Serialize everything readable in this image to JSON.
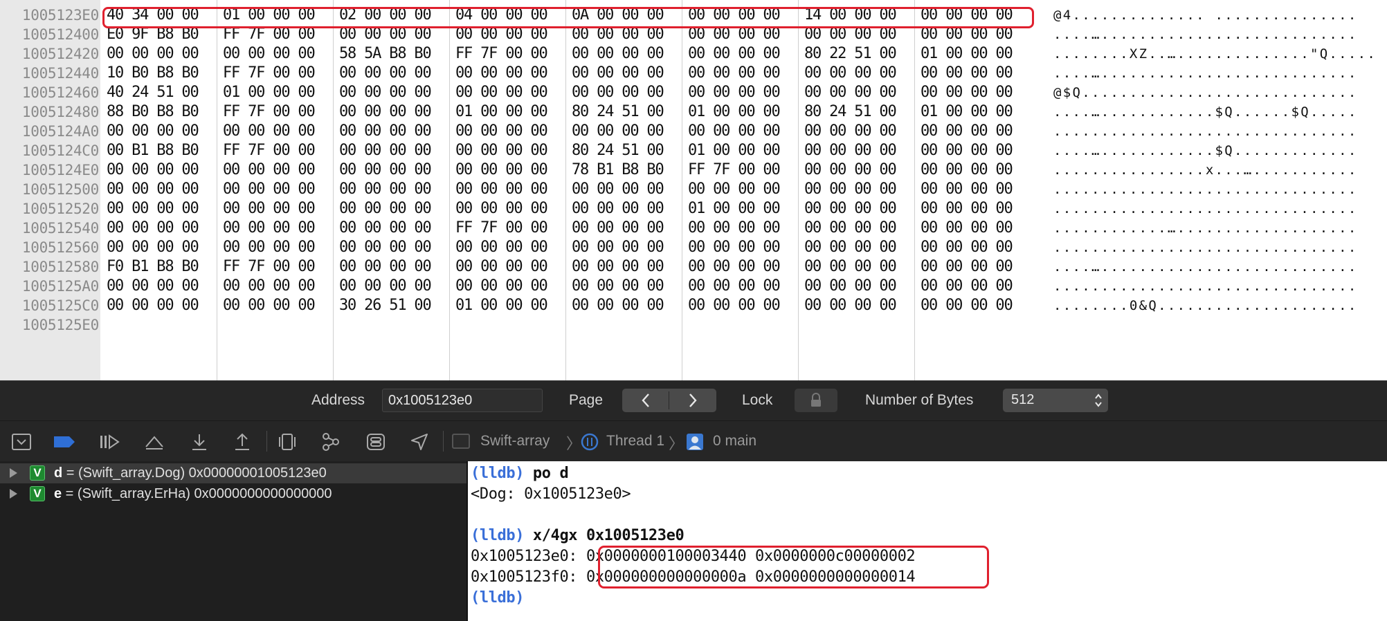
{
  "memory": {
    "rows": [
      {
        "addr": "1005123E0",
        "groups": [
          "40 34 00 00",
          "01 00 00 00",
          "02 00 00 00",
          "04 00 00 00",
          "0A 00 00 00",
          "00 00 00 00",
          "14 00 00 00",
          "00 00 00 00"
        ],
        "ascii": "@4.............. ..............."
      },
      {
        "addr": "100512400",
        "groups": [
          "E0 9F B8 B0",
          "FF 7F 00 00",
          "00 00 00 00",
          "00 00 00 00",
          "00 00 00 00",
          "00 00 00 00",
          "00 00 00 00",
          "00 00 00 00"
        ],
        "ascii": "....…..........................."
      },
      {
        "addr": "100512420",
        "groups": [
          "00 00 00 00",
          "00 00 00 00",
          "58 5A B8 B0",
          "FF 7F 00 00",
          "00 00 00 00",
          "00 00 00 00",
          "80 22 51 00",
          "01 00 00 00"
        ],
        "ascii": "........XZ..…..............\"Q....."
      },
      {
        "addr": "100512440",
        "groups": [
          "10 B0 B8 B0",
          "FF 7F 00 00",
          "00 00 00 00",
          "00 00 00 00",
          "00 00 00 00",
          "00 00 00 00",
          "00 00 00 00",
          "00 00 00 00"
        ],
        "ascii": "....…..........................."
      },
      {
        "addr": "100512460",
        "groups": [
          "40 24 51 00",
          "01 00 00 00",
          "00 00 00 00",
          "00 00 00 00",
          "00 00 00 00",
          "00 00 00 00",
          "00 00 00 00",
          "00 00 00 00"
        ],
        "ascii": "@$Q............................."
      },
      {
        "addr": "100512480",
        "groups": [
          "88 B0 B8 B0",
          "FF 7F 00 00",
          "00 00 00 00",
          "01 00 00 00",
          "80 24 51 00",
          "01 00 00 00",
          "80 24 51 00",
          "01 00 00 00"
        ],
        "ascii": "....…............$Q......$Q....."
      },
      {
        "addr": "1005124A0",
        "groups": [
          "00 00 00 00",
          "00 00 00 00",
          "00 00 00 00",
          "00 00 00 00",
          "00 00 00 00",
          "00 00 00 00",
          "00 00 00 00",
          "00 00 00 00"
        ],
        "ascii": "................................"
      },
      {
        "addr": "1005124C0",
        "groups": [
          "00 B1 B8 B0",
          "FF 7F 00 00",
          "00 00 00 00",
          "00 00 00 00",
          "80 24 51 00",
          "01 00 00 00",
          "00 00 00 00",
          "00 00 00 00"
        ],
        "ascii": "....…............$Q............."
      },
      {
        "addr": "1005124E0",
        "groups": [
          "00 00 00 00",
          "00 00 00 00",
          "00 00 00 00",
          "00 00 00 00",
          "78 B1 B8 B0",
          "FF 7F 00 00",
          "00 00 00 00",
          "00 00 00 00"
        ],
        "ascii": "................x...…..........."
      },
      {
        "addr": "100512500",
        "groups": [
          "00 00 00 00",
          "00 00 00 00",
          "00 00 00 00",
          "00 00 00 00",
          "00 00 00 00",
          "00 00 00 00",
          "00 00 00 00",
          "00 00 00 00"
        ],
        "ascii": "................................"
      },
      {
        "addr": "100512520",
        "groups": [
          "00 00 00 00",
          "00 00 00 00",
          "00 00 00 00",
          "00 00 00 00",
          "00 00 00 00",
          "01 00 00 00",
          "00 00 00 00",
          "00 00 00 00"
        ],
        "ascii": "................................"
      },
      {
        "addr": "100512540",
        "groups": [
          "00 00 00 00",
          "00 00 00 00",
          "00 00 00 00",
          "FF 7F 00 00",
          "00 00 00 00",
          "00 00 00 00",
          "00 00 00 00",
          "00 00 00 00"
        ],
        "ascii": "............…..................."
      },
      {
        "addr": "100512560",
        "groups": [
          "00 00 00 00",
          "00 00 00 00",
          "00 00 00 00",
          "00 00 00 00",
          "00 00 00 00",
          "00 00 00 00",
          "00 00 00 00",
          "00 00 00 00"
        ],
        "ascii": "................................"
      },
      {
        "addr": "100512580",
        "groups": [
          "F0 B1 B8 B0",
          "FF 7F 00 00",
          "00 00 00 00",
          "00 00 00 00",
          "00 00 00 00",
          "00 00 00 00",
          "00 00 00 00",
          "00 00 00 00"
        ],
        "ascii": "....…..........................."
      },
      {
        "addr": "1005125A0",
        "groups": [
          "00 00 00 00",
          "00 00 00 00",
          "00 00 00 00",
          "00 00 00 00",
          "00 00 00 00",
          "00 00 00 00",
          "00 00 00 00",
          "00 00 00 00"
        ],
        "ascii": "................................"
      },
      {
        "addr": "1005125C0",
        "groups": [
          "00 00 00 00",
          "00 00 00 00",
          "30 26 51 00",
          "01 00 00 00",
          "00 00 00 00",
          "00 00 00 00",
          "00 00 00 00",
          "00 00 00 00"
        ],
        "ascii": "........0&Q....................."
      },
      {
        "addr": "1005125E0",
        "groups": [],
        "ascii": ""
      }
    ]
  },
  "settings": {
    "address_label": "Address",
    "address_value": "0x1005123e0",
    "page_label": "Page",
    "lock_label": "Lock",
    "bytes_label": "Number of Bytes",
    "bytes_value": "512"
  },
  "toolbar": {
    "crumbs": [
      "Swift-array",
      "Thread 1",
      "0 main"
    ]
  },
  "variables": [
    {
      "badge": "V",
      "name": "d",
      "rest": " = (Swift_array.Dog) 0x00000001005123e0"
    },
    {
      "badge": "V",
      "name": "e",
      "rest": " = (Swift_array.ErHa) 0x0000000000000000"
    }
  ],
  "console": {
    "lines": [
      {
        "prompt": "(lldb)",
        "cmd": " po d",
        "text": ""
      },
      {
        "prompt": "",
        "cmd": "",
        "text": "<Dog: 0x1005123e0>"
      },
      {
        "prompt": "",
        "cmd": "",
        "text": ""
      },
      {
        "prompt": "(lldb)",
        "cmd": " x/4gx 0x1005123e0",
        "text": ""
      },
      {
        "prompt": "",
        "cmd": "",
        "text": "0x1005123e0: 0x0000000100003440 0x0000000c00000002"
      },
      {
        "prompt": "",
        "cmd": "",
        "text": "0x1005123f0: 0x000000000000000a 0x0000000000000014"
      },
      {
        "prompt": "(lldb)",
        "cmd": "",
        "text": ""
      }
    ]
  },
  "colors": {
    "highlight": "#e0202e",
    "prompt": "#3a6fd8",
    "var_badge": "#1e8a30"
  }
}
